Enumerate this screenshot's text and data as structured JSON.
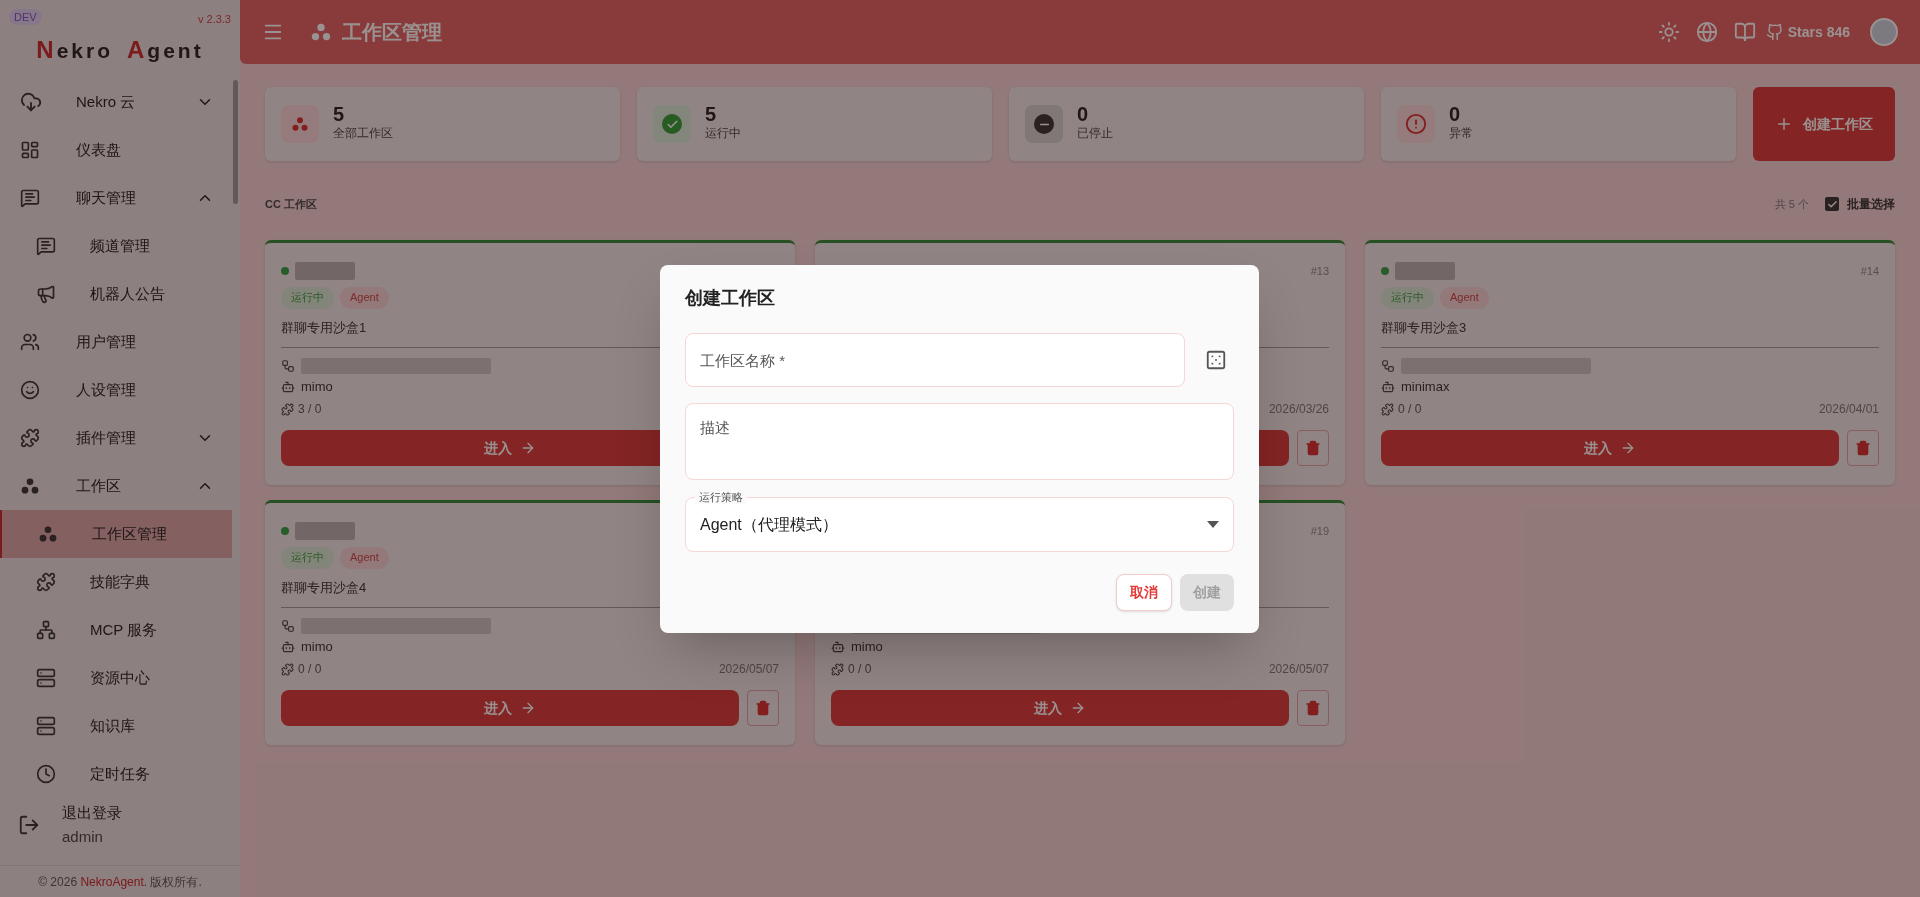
{
  "sidebar": {
    "badge": "DEV",
    "version": "v 2.3.3",
    "logo": [
      {
        "text": "N",
        "accent": true
      },
      {
        "text": "ekro",
        "accent": false
      },
      {
        "text": "A",
        "accent": true
      },
      {
        "text": "gent",
        "accent": false
      }
    ],
    "items": [
      {
        "label": "Nekro 云",
        "kind": "group",
        "expanded": false,
        "selected": false
      },
      {
        "label": "仪表盘",
        "kind": "link",
        "selected": false
      },
      {
        "label": "聊天管理",
        "kind": "group",
        "expanded": true,
        "selected": false,
        "children": [
          {
            "label": "频道管理",
            "selected": false
          },
          {
            "label": "机器人公告",
            "selected": false
          }
        ]
      },
      {
        "label": "用户管理",
        "kind": "link",
        "selected": false
      },
      {
        "label": "人设管理",
        "kind": "link",
        "selected": false
      },
      {
        "label": "插件管理",
        "kind": "group",
        "expanded": false,
        "selected": false
      },
      {
        "label": "工作区",
        "kind": "group",
        "expanded": true,
        "selected": false,
        "children": [
          {
            "label": "工作区管理",
            "selected": true
          },
          {
            "label": "技能字典",
            "selected": false
          },
          {
            "label": "MCP 服务",
            "selected": false
          },
          {
            "label": "资源中心",
            "selected": false
          },
          {
            "label": "知识库",
            "selected": false
          },
          {
            "label": "定时任务",
            "selected": false
          }
        ]
      }
    ],
    "logout": {
      "label": "退出登录",
      "user": "admin"
    },
    "footer": {
      "prefix": "© 2026 ",
      "link": "NekroAgent",
      "suffix": ". 版权所有."
    }
  },
  "topbar": {
    "title": "工作区管理",
    "stars": "Stars 846"
  },
  "stats": [
    {
      "value": "5",
      "label": "全部工作区",
      "kind": "all"
    },
    {
      "value": "5",
      "label": "运行中",
      "kind": "running"
    },
    {
      "value": "0",
      "label": "已停止",
      "kind": "stopped"
    },
    {
      "value": "0",
      "label": "异常",
      "kind": "error"
    }
  ],
  "create_button": {
    "label": "创建工作区"
  },
  "section": {
    "title": "CC 工作区",
    "count": "共 5 个",
    "batch_select": {
      "label": "批量选择",
      "checked": true
    }
  },
  "cards": [
    {
      "running": true,
      "tags": [
        {
          "label": "运行中",
          "kind": "status"
        },
        {
          "label": "Agent",
          "kind": "mode"
        }
      ],
      "description": "群聊专用沙盒1",
      "model": "mimo",
      "plugins": "3 / 0",
      "enter": "进入"
    },
    {
      "running": true,
      "id": "#13",
      "date": "2026/03/26"
    },
    {
      "running": true,
      "id": "#14",
      "tags": [
        {
          "label": "运行中",
          "kind": "status"
        },
        {
          "label": "Agent",
          "kind": "mode"
        }
      ],
      "description": "群聊专用沙盒3",
      "model": "minimax",
      "plugins": "0 / 0",
      "date": "2026/04/01",
      "enter": "进入"
    },
    {
      "running": true,
      "tags": [
        {
          "label": "运行中",
          "kind": "status"
        },
        {
          "label": "Agent",
          "kind": "mode"
        }
      ],
      "description": "群聊专用沙盒4",
      "model": "mimo",
      "plugins": "0 / 0",
      "date": "2026/05/07",
      "enter": "进入"
    },
    {
      "running": true,
      "id": "#19",
      "model": "mimo",
      "plugins": "0 / 0",
      "date": "2026/05/07",
      "enter": "进入"
    }
  ],
  "dialog": {
    "title": "创建工作区",
    "name_field": {
      "placeholder": "工作区名称 *"
    },
    "description_field": {
      "placeholder": "描述"
    },
    "strategy_select": {
      "label": "运行策略",
      "value": "Agent（代理模式）"
    },
    "buttons": [
      {
        "label": "取消",
        "kind": "cancel",
        "disabled": false
      },
      {
        "label": "创建",
        "kind": "primary",
        "disabled": true
      }
    ]
  }
}
